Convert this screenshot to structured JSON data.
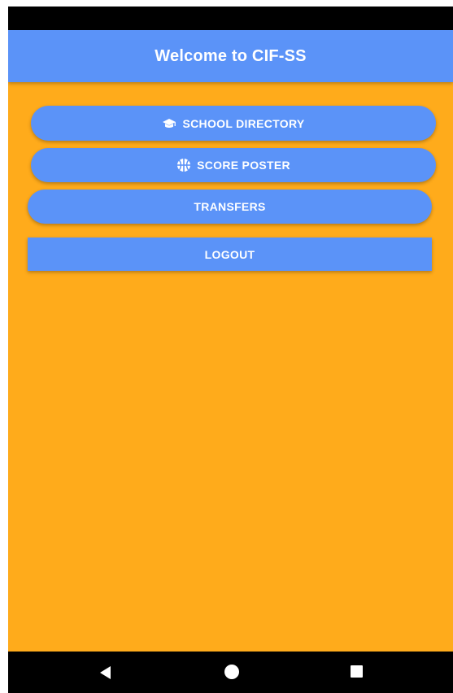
{
  "app_bar": {
    "title": "Welcome to CIF-SS"
  },
  "buttons": {
    "school_directory": {
      "label": "SCHOOL DIRECTORY",
      "icon": "graduation-cap-icon"
    },
    "score_poster": {
      "label": "SCORE POSTER",
      "icon": "basketball-icon"
    },
    "transfers": {
      "label": "TRANSFERS"
    },
    "logout": {
      "label": "LOGOUT"
    }
  },
  "nav_bar": {
    "back": "back-triangle-icon",
    "home": "home-circle-icon",
    "recents": "recents-square-icon"
  },
  "colors": {
    "background": "#FFAB1B",
    "primary": "#5B93F8",
    "text_on_primary": "#FFFFFF",
    "system_bars": "#000000"
  }
}
